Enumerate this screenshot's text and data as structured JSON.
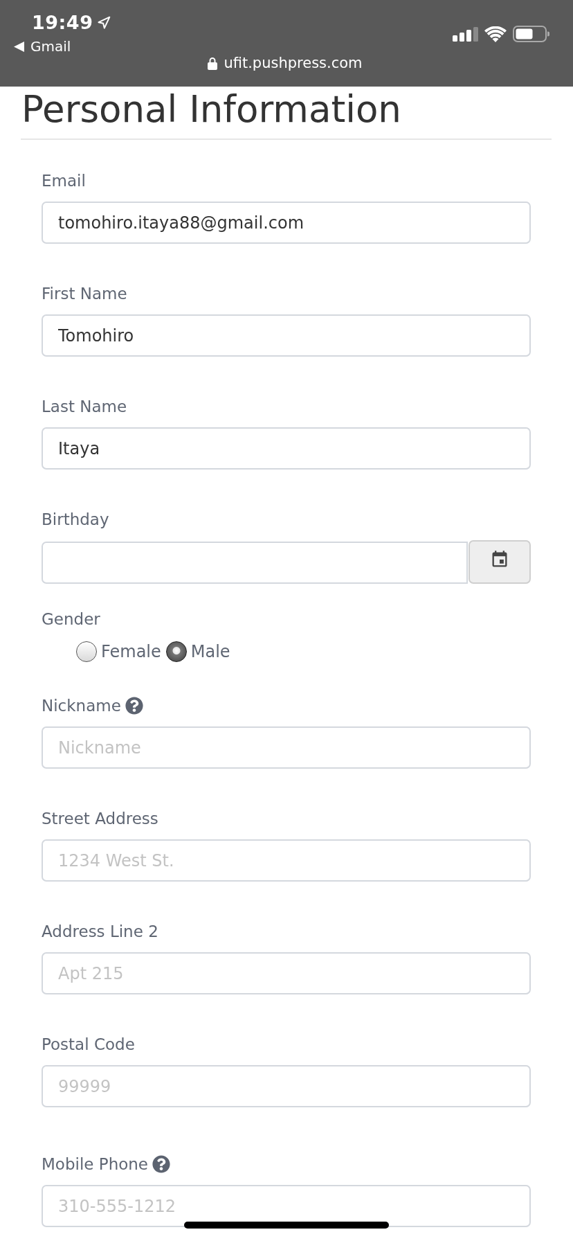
{
  "status_bar": {
    "time": "19:49",
    "back_label": "Gmail",
    "url": "ufit.pushpress.com"
  },
  "page_title": "Personal Information",
  "fields": [
    {
      "kind": "text",
      "label": "Email",
      "help": false,
      "value": "tomohiro.itaya88@gmail.com"
    },
    {
      "kind": "text",
      "label": "First Name",
      "help": false,
      "value": "Tomohiro"
    },
    {
      "kind": "text",
      "label": "Last Name",
      "help": false,
      "value": "Itaya"
    },
    {
      "kind": "date",
      "label": "Birthday",
      "help": false
    },
    {
      "kind": "radio",
      "label": "Gender",
      "help": false,
      "options": [
        {
          "label": "Female",
          "selected": false
        },
        {
          "label": "Male",
          "selected": true
        }
      ]
    },
    {
      "kind": "text",
      "label": "Nickname",
      "help": true,
      "placeholder": "Nickname"
    },
    {
      "kind": "text",
      "label": "Street Address",
      "help": false,
      "placeholder": "1234 West St."
    },
    {
      "kind": "text",
      "label": "Address Line 2",
      "help": false,
      "placeholder": "Apt 215"
    },
    {
      "kind": "text",
      "label": "Postal Code",
      "help": false,
      "placeholder": "99999"
    },
    {
      "kind": "text",
      "label": "Mobile Phone",
      "help": true,
      "placeholder": "310-555-1212"
    }
  ]
}
